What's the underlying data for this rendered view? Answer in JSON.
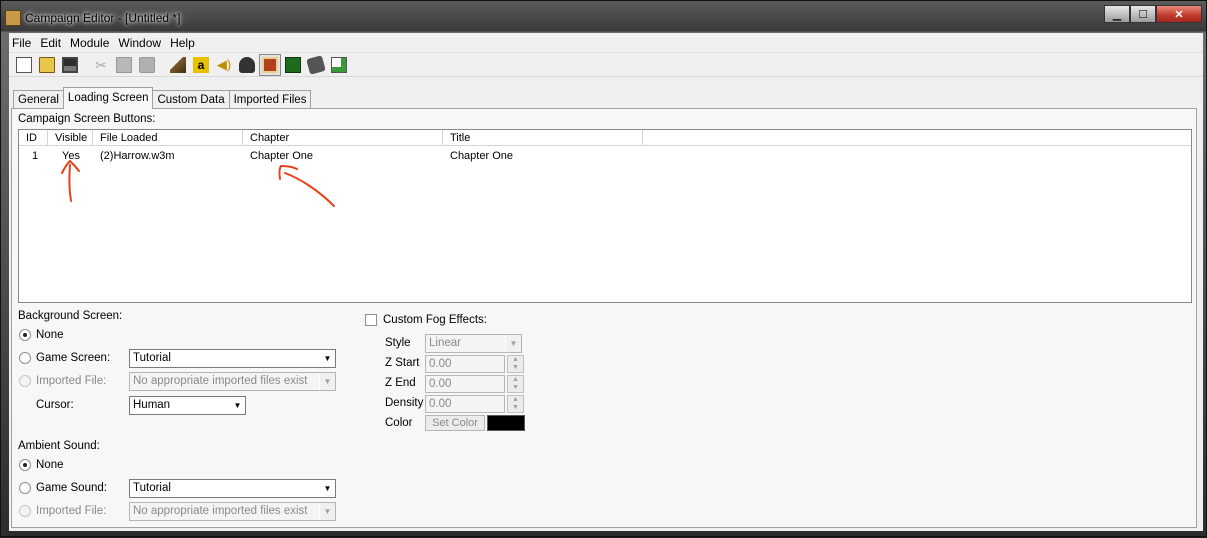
{
  "window": {
    "title": "Campaign Editor - [Untitled *]"
  },
  "menu": [
    "File",
    "Edit",
    "Module",
    "Window",
    "Help"
  ],
  "toolbar_icons": [
    "new-file-icon",
    "open-folder-icon",
    "save-icon",
    "cut-icon",
    "copy-icon",
    "paste-icon",
    "terrain-icon",
    "font-a-icon",
    "sound-icon",
    "ai-editor-icon",
    "campaign-editor-icon",
    "map-icon",
    "object-editor-icon",
    "import-icon"
  ],
  "tabs": [
    "General",
    "Loading Screen",
    "Custom Data",
    "Imported Files"
  ],
  "list": {
    "label": "Campaign Screen Buttons:",
    "columns": [
      "ID",
      "Visible",
      "File Loaded",
      "Chapter",
      "Title"
    ],
    "rows": [
      {
        "id": "1",
        "visible": "Yes",
        "file": "(2)Harrow.w3m",
        "chapter": "Chapter One",
        "title": "Chapter One"
      }
    ]
  },
  "background": {
    "label": "Background Screen:",
    "none_label": "None",
    "game_screen_label": "Game Screen:",
    "game_screen_value": "Tutorial",
    "imported_label": "Imported File:",
    "imported_value": "No appropriate imported files exist",
    "cursor_label": "Cursor:",
    "cursor_value": "Human"
  },
  "ambient": {
    "label": "Ambient Sound:",
    "none_label": "None",
    "game_sound_label": "Game Sound:",
    "game_sound_value": "Tutorial",
    "imported_label": "Imported File:",
    "imported_value": "No appropriate imported files exist"
  },
  "fog": {
    "label": "Custom Fog Effects:",
    "style_label": "Style",
    "style_value": "Linear",
    "zstart_label": "Z Start",
    "zstart_value": "0.00",
    "zend_label": "Z End",
    "zend_value": "0.00",
    "density_label": "Density",
    "density_value": "0.00",
    "color_label": "Color",
    "set_color_label": "Set Color",
    "color_hex": "#000000"
  },
  "annotation_color": "#e8401c"
}
